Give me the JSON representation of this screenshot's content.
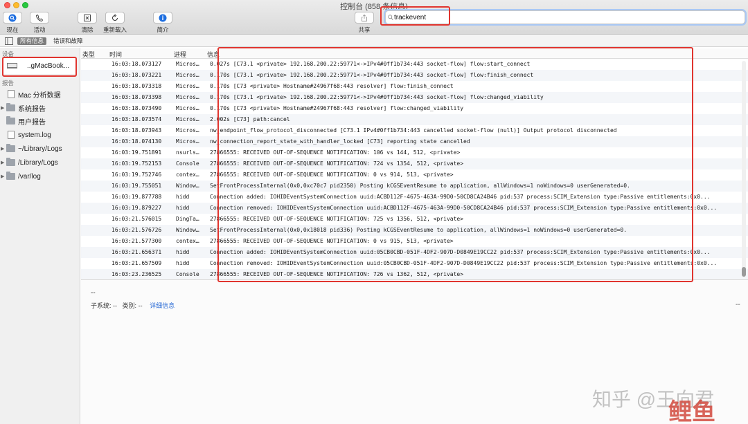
{
  "window": {
    "title": "控制台 (858 条信息)"
  },
  "toolbar": {
    "now": "现在",
    "activity": "活动",
    "clear": "清除",
    "reload": "重新载入",
    "info": "简介",
    "share": "共享"
  },
  "search": {
    "value": "trackevent"
  },
  "scope": {
    "all": "所有信息",
    "errors": "错误和故障"
  },
  "sidebar": {
    "devices_header": "设备",
    "device_name": "..gMacBook...",
    "reports_header": "报告",
    "items": [
      {
        "label": "Mac 分析数据",
        "kind": "doc",
        "expandable": false
      },
      {
        "label": "系统报告",
        "kind": "folder",
        "expandable": true
      },
      {
        "label": "用户报告",
        "kind": "folder",
        "expandable": false
      },
      {
        "label": "system.log",
        "kind": "doc",
        "expandable": false
      },
      {
        "label": "~/Library/Logs",
        "kind": "folder",
        "expandable": true
      },
      {
        "label": "/Library/Logs",
        "kind": "folder",
        "expandable": true
      },
      {
        "label": "/var/log",
        "kind": "folder",
        "expandable": true
      }
    ]
  },
  "columns": {
    "type": "类型",
    "time": "时间",
    "process": "进程",
    "message": "信息"
  },
  "rows": [
    {
      "time": "16:03:18.073127",
      "process": "Micros…",
      "message": "0.027s [C73.1 <private> 192.168.200.22:59771<->IPv4#0ff1b734:443 socket-flow] flow:start_connect"
    },
    {
      "time": "16:03:18.073221",
      "process": "Micros…",
      "message": "0.170s [C73.1 <private> 192.168.200.22:59771<->IPv4#0ff1b734:443 socket-flow] flow:finish_connect"
    },
    {
      "time": "16:03:18.073318",
      "process": "Micros…",
      "message": "0.170s [C73 <private> Hostname#24967f68:443 resolver] flow:finish_connect"
    },
    {
      "time": "16:03:18.073398",
      "process": "Micros…",
      "message": "0.170s [C73.1 <private> 192.168.200.22:59771<->IPv4#0ff1b734:443 socket-flow] flow:changed_viability"
    },
    {
      "time": "16:03:18.073490",
      "process": "Micros…",
      "message": "0.170s [C73 <private> Hostname#24967f68:443 resolver] flow:changed_viability"
    },
    {
      "time": "16:03:18.073574",
      "process": "Micros…",
      "message": "2.002s [C73] path:cancel"
    },
    {
      "time": "16:03:18.073943",
      "process": "Micros…",
      "message": "nw_endpoint_flow_protocol_disconnected [C73.1 IPv4#0ff1b734:443 cancelled socket-flow (null)] Output protocol disconnected"
    },
    {
      "time": "16:03:18.074130",
      "process": "Micros…",
      "message": "nw_connection_report_state_with_handler_locked [C73] reporting state cancelled"
    },
    {
      "time": "16:03:19.751891",
      "process": "nsurls…",
      "message": "27866555: RECEIVED OUT-OF-SEQUENCE NOTIFICATION: 106 vs 144, 512, <private>"
    },
    {
      "time": "16:03:19.752153",
      "process": "Console",
      "message": "27866555: RECEIVED OUT-OF-SEQUENCE NOTIFICATION: 724 vs 1354, 512, <private>"
    },
    {
      "time": "16:03:19.752746",
      "process": "contex…",
      "message": "27866555: RECEIVED OUT-OF-SEQUENCE NOTIFICATION: 0 vs 914, 513, <private>"
    },
    {
      "time": "16:03:19.755051",
      "process": "Window…",
      "message": "SetFrontProcessInternal(0x0,0xc70c7 pid2350) Posting kCGSEventResume to application, allWindows=1 noWindows=0 userGenerated=0."
    },
    {
      "time": "16:03:19.877788",
      "process": "hidd",
      "message": "Connection added: IOHIDEventSystemConnection uuid:ACBD112F-4675-463A-99D0-50CD8CA24B46 pid:537 process:SCIM_Extension type:Passive entitlements:0x0..."
    },
    {
      "time": "16:03:19.879227",
      "process": "hidd",
      "message": "Connection removed: IOHIDEventSystemConnection uuid:ACBD112F-4675-463A-99D0-50CD8CA24B46 pid:537 process:SCIM_Extension type:Passive entitlements:0x0..."
    },
    {
      "time": "16:03:21.576015",
      "process": "DingTa…",
      "message": "27866555: RECEIVED OUT-OF-SEQUENCE NOTIFICATION: 725 vs 1356, 512, <private>"
    },
    {
      "time": "16:03:21.576726",
      "process": "Window…",
      "message": "SetFrontProcessInternal(0x0,0x18018 pid336) Posting kCGSEventResume to application, allWindows=1 noWindows=0 userGenerated=0."
    },
    {
      "time": "16:03:21.577300",
      "process": "contex…",
      "message": "27866555: RECEIVED OUT-OF-SEQUENCE NOTIFICATION: 0 vs 915, 513, <private>"
    },
    {
      "time": "16:03:21.656371",
      "process": "hidd",
      "message": "Connection added: IOHIDEventSystemConnection uuid:05CB0CBD-051F-4DF2-907D-D0849E19CC22 pid:537 process:SCIM_Extension type:Passive entitlements:0x0..."
    },
    {
      "time": "16:03:21.657509",
      "process": "hidd",
      "message": "Connection removed: IOHIDEventSystemConnection uuid:05CB0CBD-051F-4DF2-907D-D0849E19CC22 pid:537 process:SCIM_Extension type:Passive entitlements:0x0..."
    },
    {
      "time": "16:03:23.236525",
      "process": "Console",
      "message": "27866555: RECEIVED OUT-OF-SEQUENCE NOTIFICATION: 726 vs 1362, 512, <private>"
    }
  ],
  "details": {
    "dash": "--",
    "subsystem_label": "子系统:",
    "subsystem_value": "--",
    "category_label": "类别:",
    "category_value": "--",
    "more_info": "详细信息",
    "dash_right": "--"
  },
  "watermark": {
    "text": "知乎 @王向君",
    "logo": "鲤鱼"
  },
  "colors": {
    "highlight": "#e0352f",
    "accent": "#2a6bd6",
    "selected_scope": "#7c7c7c"
  }
}
